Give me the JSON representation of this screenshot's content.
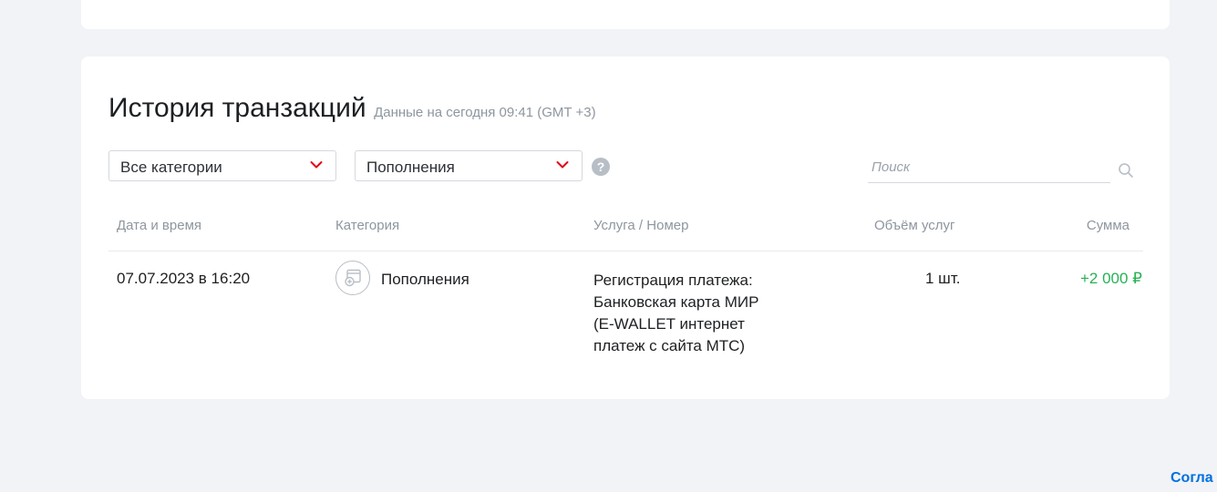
{
  "history": {
    "title": "История транзакций",
    "subtitle": "Данные на сегодня 09:41 (GMT +3)"
  },
  "filters": {
    "category_select": "Все категории",
    "type_select": "Пополнения",
    "help_icon": "?"
  },
  "search": {
    "placeholder": "Поиск",
    "value": ""
  },
  "table": {
    "columns": [
      "Дата и время",
      "Категория",
      "Услуга / Номер",
      "Объём услуг",
      "Сумма"
    ],
    "rows": [
      {
        "datetime": "07.07.2023 в 16:20",
        "category": "Пополнения",
        "service_lines": [
          "Регистрация платежа:",
          "Банковская карта МИР",
          "(E-WALLET интернет",
          "платеж с сайта МТС)"
        ],
        "volume": "1 шт.",
        "amount": "+2 000 ₽"
      }
    ]
  },
  "footer": {
    "link_text": "Согла"
  },
  "colors": {
    "background": "#f1f3f7",
    "card": "#ffffff",
    "accent_red": "#e30611",
    "amount_positive": "#26b255",
    "link_blue": "#0070e0",
    "muted_text": "#8d969f"
  },
  "icons": {
    "chevron": "chevron-down-icon",
    "search": "search-icon",
    "help": "question-icon",
    "category": "wallet-plus-icon"
  }
}
